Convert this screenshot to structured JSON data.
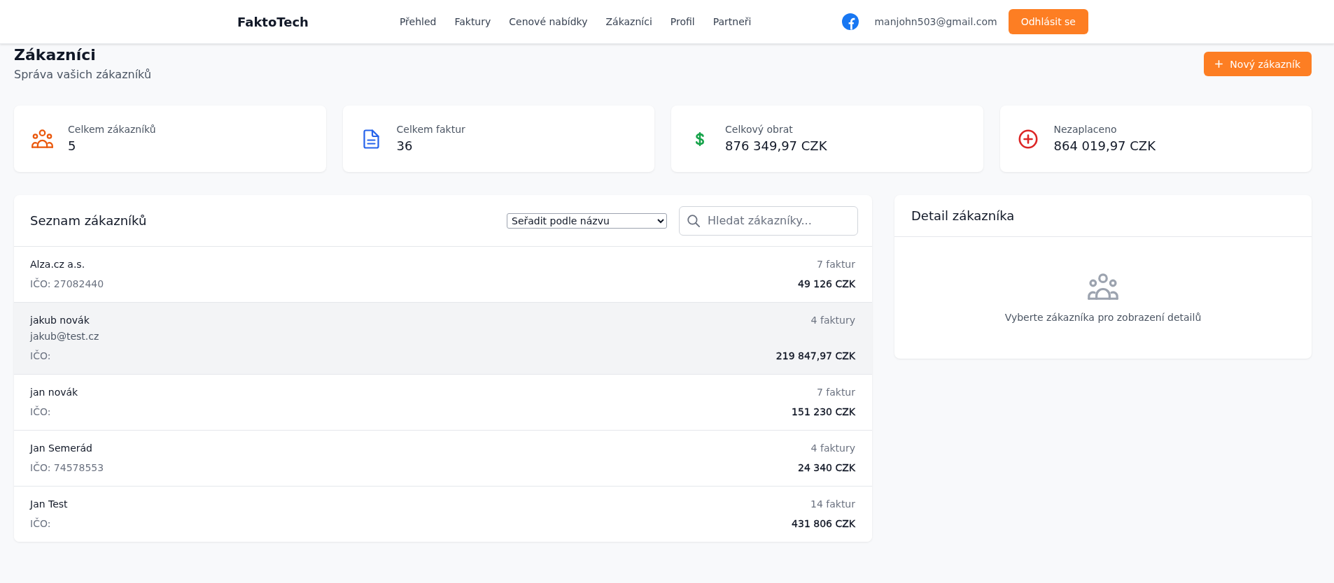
{
  "header": {
    "logo": "FaktoTech",
    "nav": [
      "Přehled",
      "Faktury",
      "Cenové nabídky",
      "Zákazníci",
      "Profil",
      "Partneři"
    ],
    "user_email": "manjohn503@gmail.com",
    "logout_button": "Odhlásit se"
  },
  "page": {
    "title": "Zákazníci",
    "subtitle": "Správa vašich zákazníků",
    "new_button": "Nový zákazník"
  },
  "stats": [
    {
      "kind": "customers",
      "label": "Celkem zákazníků",
      "value": "5",
      "color": "#ea580c"
    },
    {
      "kind": "invoices",
      "label": "Celkem faktur",
      "value": "36",
      "color": "#2563eb"
    },
    {
      "kind": "revenue",
      "label": "Celkový obrat",
      "value": "876 349,97 CZK",
      "color": "#16a34a"
    },
    {
      "kind": "unpaid",
      "label": "Nezaplaceno",
      "value": "864 019,97 CZK",
      "color": "#dc2626"
    }
  ],
  "customer_list": {
    "title": "Seznam zákazníků",
    "sort_select": "Seřadit podle názvu",
    "search": {
      "placeholder": "Hledat zákazníky..."
    },
    "rows": [
      {
        "name": "Alza.cz a.s.",
        "ico": "IČO: 27082440",
        "invoices": "7 faktur",
        "amount": "49 126 CZK",
        "highlighted": false
      },
      {
        "name": "jakub novák",
        "email": "jakub@test.cz",
        "ico": "IČO:",
        "invoices": "4 faktury",
        "amount": "219 847,97 CZK",
        "highlighted": true
      },
      {
        "name": "jan novák",
        "ico": "IČO:",
        "invoices": "7 faktur",
        "amount": "151 230 CZK",
        "highlighted": false
      },
      {
        "name": "Jan Semerád",
        "ico": "IČO: 74578553",
        "invoices": "4 faktury",
        "amount": "24 340 CZK",
        "highlighted": false
      },
      {
        "name": "Jan Test",
        "ico": "IČO:",
        "invoices": "14 faktur",
        "amount": "431 806 CZK",
        "highlighted": false
      }
    ]
  },
  "detail_panel": {
    "title": "Detail zákazníka",
    "empty_message": "Vyberte zákazníka pro zobrazení detailů"
  }
}
